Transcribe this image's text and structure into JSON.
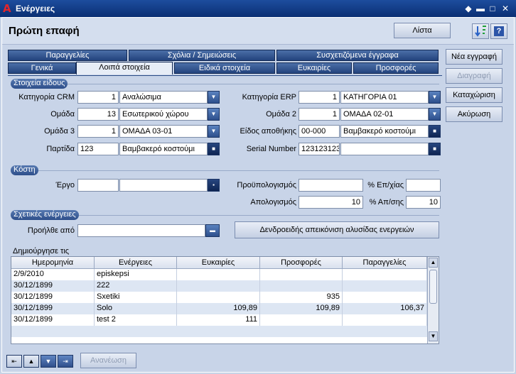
{
  "window": {
    "title": "Ενέργειες"
  },
  "header": {
    "page_title": "Πρώτη επαφή",
    "list_button": "Λίστα"
  },
  "tabs_top": [
    {
      "label": "Παραγγελίες"
    },
    {
      "label": "Σχόλια / Σημειώσεις"
    },
    {
      "label": "Συσχετιζόμενα έγγραφα"
    }
  ],
  "tabs_bottom": [
    {
      "label": "Γενικά"
    },
    {
      "label": "Λοιπά στοιχεία"
    },
    {
      "label": "Ειδικά στοιχεία"
    },
    {
      "label": "Ευκαιρίες"
    },
    {
      "label": "Προσφορές"
    }
  ],
  "actions": {
    "new": "Νέα εγγραφή",
    "delete": "Διαγραφή",
    "save": "Καταχώριση",
    "cancel": "Ακύρωση"
  },
  "item_section": {
    "title": "Στοιχεία είδους",
    "crm_category": {
      "label": "Κατηγορία CRM",
      "code": "1",
      "name": "Αναλώσιμα"
    },
    "group": {
      "label": "Ομάδα",
      "code": "13",
      "name": "Εσωτερικού χώρου"
    },
    "group3": {
      "label": "Ομάδα 3",
      "code": "1",
      "name": "ΟΜΑΔΑ 03-01"
    },
    "batch": {
      "label": "Παρτίδα",
      "code": "123",
      "name": "Βαμβακερό κοστούμι"
    },
    "erp_category": {
      "label": "Κατηγορία ERP",
      "code": "1",
      "name": "ΚΑΤΗΓΟΡΙΑ 01"
    },
    "group2": {
      "label": "Ομάδα 2",
      "code": "1",
      "name": "ΟΜΑΔΑ 02-01"
    },
    "warehouse_item": {
      "label": "Είδος αποθήκης",
      "code": "00-000",
      "name": "Βαμβακερό κοστούμι"
    },
    "serial": {
      "label": "Serial Number",
      "code": "123123123",
      "name": ""
    }
  },
  "cost_section": {
    "title": "Κόστη",
    "project": {
      "label": "Έργο",
      "code": "",
      "name": ""
    },
    "budget": {
      "label": "Προϋπολογισμός",
      "value": ""
    },
    "actual": {
      "label": "Απολογισμός",
      "value": "10"
    },
    "pct_exec": {
      "label": "% Επ/χίας",
      "value": ""
    },
    "pct_real": {
      "label": "% Απ/σης",
      "value": "10"
    }
  },
  "related_section": {
    "title": "Σχετικές ενέργειες",
    "origin": {
      "label": "Προήλθε από",
      "value": ""
    },
    "tree_button": "Δενδροειδής απεικόνιση αλυσίδας ενεργειών",
    "created_label": "Δημιούργησε τις"
  },
  "grid": {
    "columns": [
      "Ημερομηνία",
      "Ενέργειες",
      "Ευκαιρίες",
      "Προσφορές",
      "Παραγγελίες"
    ],
    "rows": [
      [
        "2/9/2010",
        "episkepsi",
        "",
        "",
        ""
      ],
      [
        "30/12/1899",
        "222",
        "",
        "",
        ""
      ],
      [
        "30/12/1899",
        "Sxetiki",
        "",
        "935",
        ""
      ],
      [
        "30/12/1899",
        "Solo",
        "109,89",
        "109,89",
        "106,37"
      ],
      [
        "30/12/1899",
        "test 2",
        "111",
        "",
        ""
      ]
    ]
  },
  "bottom": {
    "refresh": "Ανανέωση"
  }
}
